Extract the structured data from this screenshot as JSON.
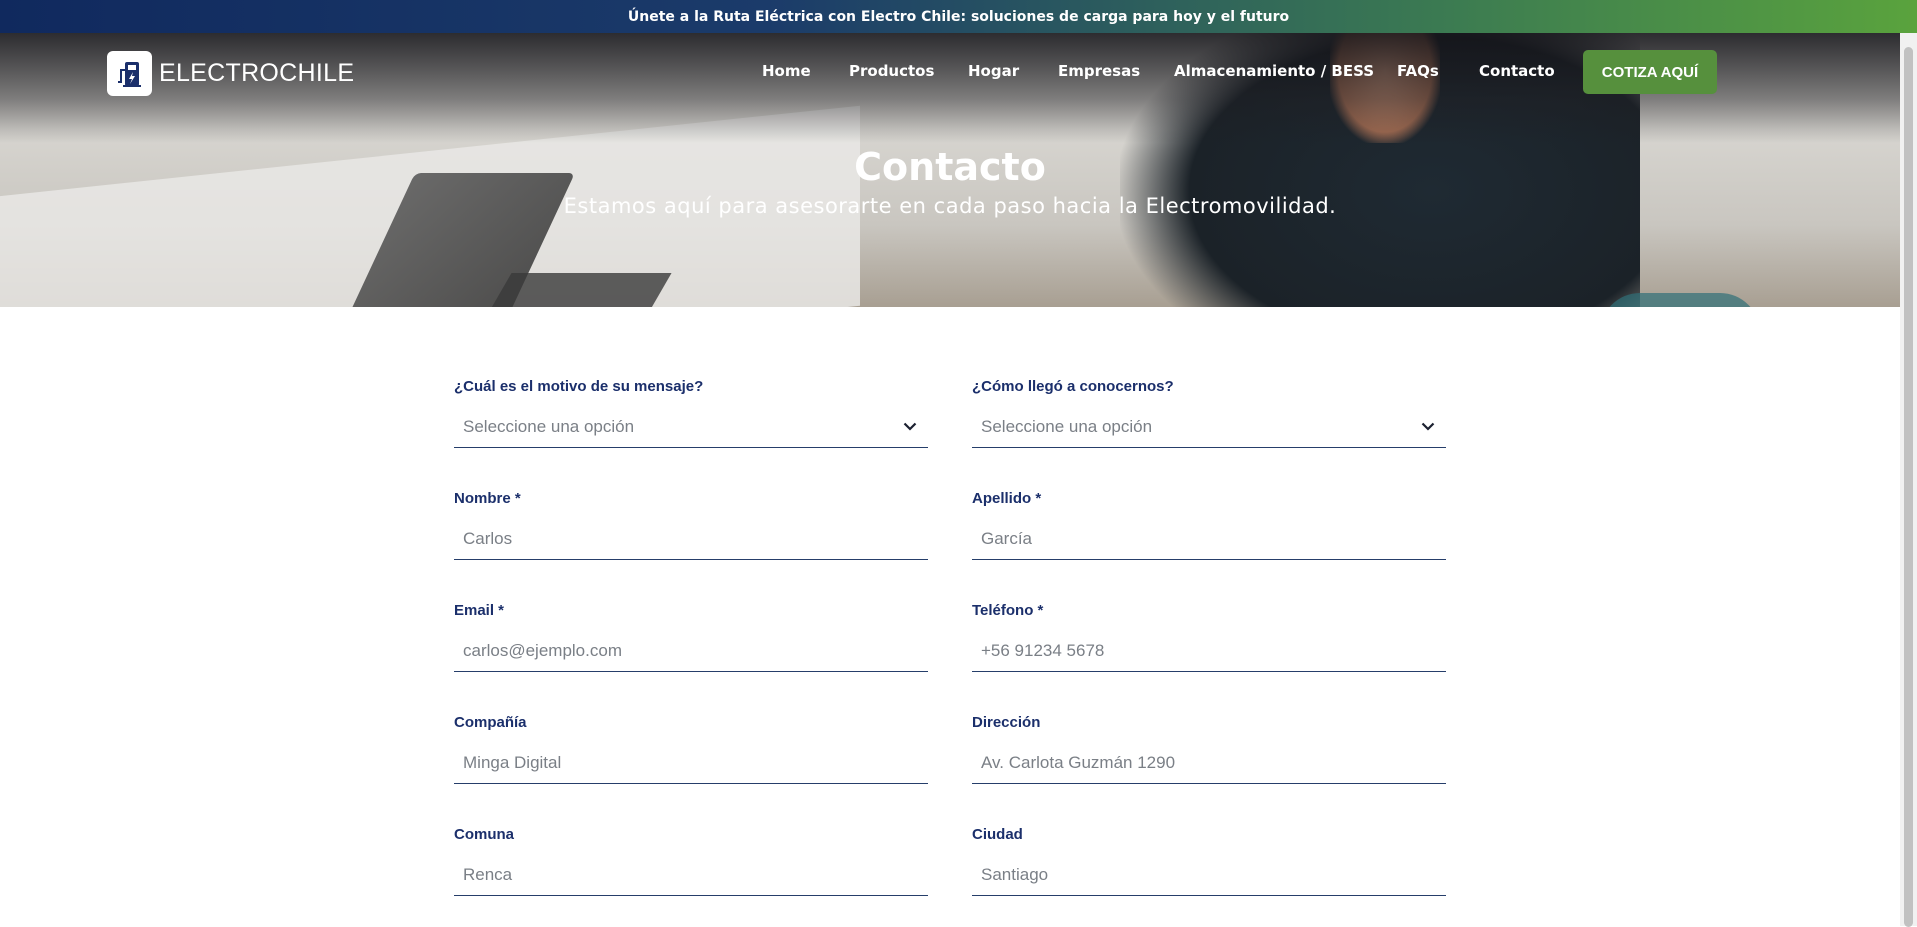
{
  "announcement": "Únete a la Ruta Eléctrica con Electro Chile: soluciones de carga para hoy y el futuro",
  "brand": {
    "name": "ELECTROCHILE",
    "icon": "ev-charger-icon"
  },
  "nav": {
    "items": [
      "Home",
      "Productos",
      "Hogar",
      "Empresas",
      "Almacenamiento / BESS",
      "FAQs",
      "Contacto"
    ],
    "cta": "COTIZA AQUÍ"
  },
  "hero": {
    "title": "Contacto",
    "subtitle": "Estamos aquí para asesorarte en cada paso hacia la Electromovilidad."
  },
  "form": {
    "motivo": {
      "label": "¿Cuál es el motivo de su mensaje?",
      "value": "Seleccione una opción"
    },
    "origen": {
      "label": "¿Cómo llegó a conocernos?",
      "value": "Seleccione una opción"
    },
    "nombre": {
      "label": "Nombre *",
      "value": "Carlos"
    },
    "apellido": {
      "label": "Apellido *",
      "value": "García"
    },
    "email": {
      "label": "Email *",
      "value": "carlos@ejemplo.com"
    },
    "telefono": {
      "label": "Teléfono *",
      "value": "+56 91234 5678"
    },
    "compania": {
      "label": "Compañía",
      "value": "Minga Digital"
    },
    "direccion": {
      "label": "Dirección",
      "value": "Av. Carlota Guzmán 1290"
    },
    "comuna": {
      "label": "Comuna",
      "value": "Renca"
    },
    "ciudad": {
      "label": "Ciudad",
      "value": "Santiago"
    }
  },
  "colors": {
    "brand_blue": "#1b2f6b",
    "cta_green": "#56903d",
    "field_line": "#263e6a"
  }
}
